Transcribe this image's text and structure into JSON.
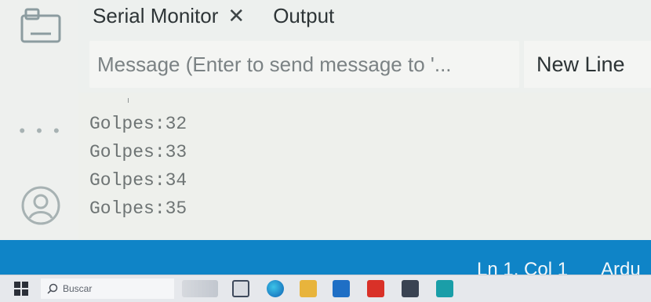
{
  "tabs": {
    "serial_monitor": "Serial Monitor",
    "close_glyph": "✕",
    "output": "Output"
  },
  "message": {
    "placeholder": "Message (Enter to send message to '...",
    "line_ending": "New Line"
  },
  "serial_output": {
    "stray_mark": "ı",
    "lines": [
      "Golpes:32",
      "Golpes:33",
      "Golpes:34",
      "Golpes:35"
    ]
  },
  "status_bar": {
    "position": "Ln 1, Col 1",
    "board": "Ardu"
  },
  "taskbar": {
    "search_text": "Buscar",
    "icons": [
      "windows-start-icon",
      "search-icon",
      "weather-widget-icon",
      "task-view-icon",
      "edge-icon",
      "file-explorer-icon",
      "mail-icon",
      "youtube-icon",
      "amazon-icon",
      "arduino-icon"
    ]
  },
  "rail": {
    "more_glyph": "• • •"
  },
  "colors": {
    "status_bar": "#0f84c7",
    "panel_bg": "#eef0ec",
    "text_dark": "#2e3537"
  }
}
